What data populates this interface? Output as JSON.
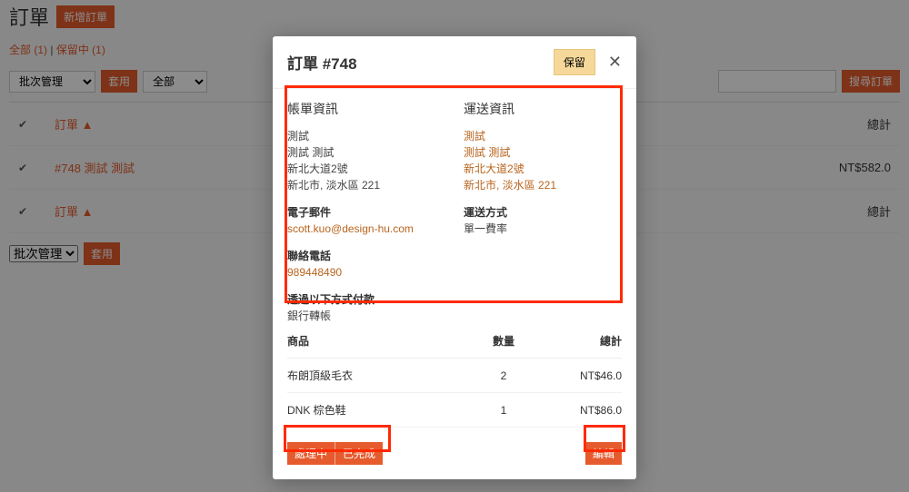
{
  "page": {
    "title": "訂單",
    "new_order_btn": "新增訂單",
    "filter_all": "全部 (1)",
    "filter_onhold": "保留中 (1)",
    "bulk_select": "批次管理",
    "apply_btn": "套用",
    "all_option": "全部",
    "search_btn": "搜尋訂單"
  },
  "table": {
    "col_order": "訂單 ▲",
    "col_total": "總計",
    "rows": [
      {
        "order": "#748 測試 測試",
        "total": "NT$582.0"
      }
    ]
  },
  "modal": {
    "title": "訂單 #748",
    "hold_btn": "保留",
    "close": "✕",
    "billing_title": "帳單資訊",
    "shipping_title": "運送資訊",
    "billing": {
      "name": "測試",
      "name2": "測試 測試",
      "addr1": "新北大道2號",
      "addr2": "新北市, 淡水區 221",
      "email_label": "電子郵件",
      "email": "scott.kuo@design-hu.com",
      "phone_label": "聯絡電話",
      "phone": "989448490",
      "pay_label": "透過以下方式付款",
      "pay_method": "銀行轉帳"
    },
    "shipping": {
      "name": "測試",
      "name2": "測試 測試",
      "addr1": "新北大道2號",
      "addr2": "新北市, 淡水區 221",
      "ship_label": "運送方式",
      "ship_method": "單一費率"
    },
    "prod_head": {
      "name": "商品",
      "qty": "數量",
      "total": "總計"
    },
    "products": [
      {
        "name": "布朗頂級毛衣",
        "qty": "2",
        "total": "NT$46.0"
      },
      {
        "name": "DNK 棕色鞋",
        "qty": "1",
        "total": "NT$86.0"
      }
    ],
    "btn_processing": "處理中",
    "btn_done": "已完成",
    "btn_edit": "編輯"
  }
}
